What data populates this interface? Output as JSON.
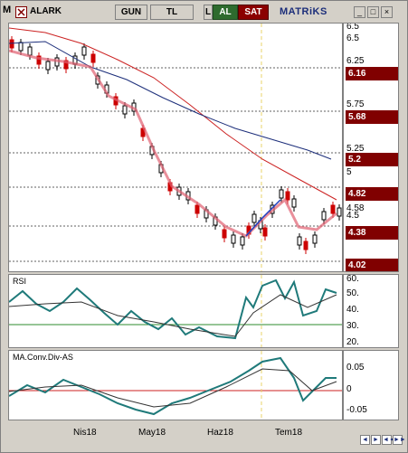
{
  "toolbar": {
    "logo": "M",
    "symbol": "ALARK",
    "buttons": [
      {
        "label": "GUN"
      },
      {
        "label": "TL"
      },
      {
        "label": "L"
      },
      {
        "label": "AL"
      },
      {
        "label": "SAT"
      }
    ],
    "brand": "MATRiKS",
    "window_buttons": [
      "_",
      "□",
      "×"
    ]
  },
  "colors": {
    "price_tag": "#800000",
    "candle_up": "#000000",
    "candle_down": "#cc0000",
    "ma_fast": "#1f3fbf",
    "ma_slow_red": "#cc2222",
    "ma_long_blue": "#1c2e7a",
    "rsi_line": "#1f7a7a",
    "grid_green": "#2e8b2e",
    "vline": "#e8d36a"
  },
  "price_scale": {
    "labels": [
      "6.5",
      "6.25",
      "5.75",
      "5.25",
      "5",
      "4.58",
      "4.5"
    ],
    "tags": [
      "6.16",
      "5.68",
      "5.2",
      "4.82",
      "4.38",
      "4.02"
    ]
  },
  "rsi_panel": {
    "label": "RSI",
    "scale": [
      "60.",
      "50.",
      "40.",
      "30.",
      "20."
    ]
  },
  "macd_panel": {
    "label": "MA.Conv.Div-AS",
    "scale": [
      "0.05",
      "0",
      "-0.05"
    ]
  },
  "x_axis": {
    "labels": [
      "Nis18",
      "May18",
      "Haz18",
      "Tem18"
    ]
  },
  "nav": [
    "◄",
    "►",
    "◄◄",
    "►►"
  ]
}
